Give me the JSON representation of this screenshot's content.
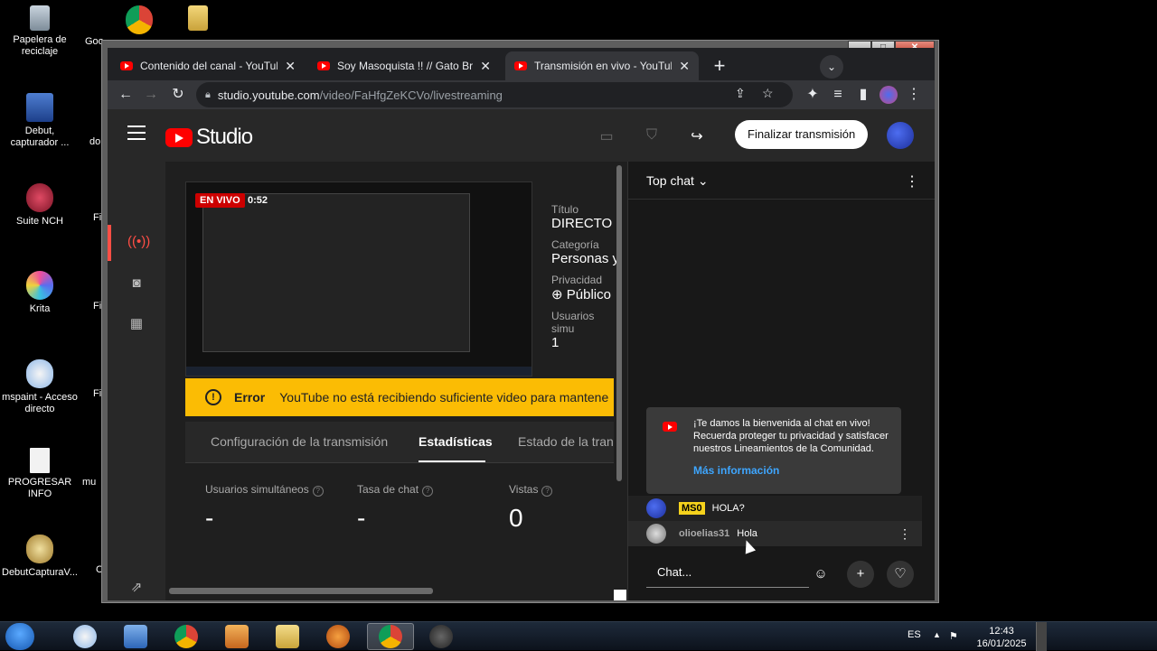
{
  "desktop": {
    "icons": [
      {
        "label": "Papelera de reciclaje",
        "icon": "recycle-bin-icon",
        "color": "#8fa3b5"
      },
      {
        "label": "Debut, capturador ...",
        "icon": "debut-icon",
        "color": "#2f5fb3"
      },
      {
        "label": "Suite NCH",
        "icon": "nch-suite-icon",
        "color": "#c0304a"
      },
      {
        "label": "Krita",
        "icon": "krita-icon",
        "color": "#d94bd6"
      },
      {
        "label": "mspaint - Acceso directo",
        "icon": "mspaint-icon",
        "color": "#e6c24a"
      },
      {
        "label": "PROGRESAR INFO",
        "icon": "document-icon",
        "color": "#f2f2f2"
      },
      {
        "label": "DebutCapturaV...",
        "icon": "installer-icon",
        "color": "#c9a44a"
      }
    ],
    "clipped_labels": [
      "Goo",
      "do",
      "Fi",
      "Fi",
      "Fi",
      "mu",
      "C"
    ]
  },
  "browser": {
    "tabs": [
      {
        "title": "Contenido del canal - YouTube St",
        "active": false
      },
      {
        "title": "Soy Masoquista !! // Gato Bros -",
        "active": false
      },
      {
        "title": "Transmisión en vivo - YouTube St",
        "active": true
      }
    ],
    "new_tab": "+",
    "url_host": "studio.youtube.com",
    "url_path": "/video/FaHfgZeKCVo/livestreaming"
  },
  "studio": {
    "logo_text": "Studio",
    "end_button": "Finalizar transmisión",
    "live_badge": "EN VIVO",
    "live_time": "0:52",
    "meta": {
      "title_label": "Título",
      "title_value": "DIRECTO",
      "category_label": "Categoría",
      "category_value": "Personas y",
      "privacy_label": "Privacidad",
      "privacy_value": "Público",
      "viewers_label": "Usuarios simu",
      "viewers_value": "1"
    },
    "error": {
      "title": "Error",
      "message": "YouTube no está recibiendo suficiente video para mantene"
    },
    "tabs": [
      {
        "label": "Configuración de la transmisión",
        "active": false
      },
      {
        "label": "Estadísticas",
        "active": true
      },
      {
        "label": "Estado de la trans",
        "active": false
      }
    ],
    "stats": [
      {
        "label": "Usuarios simultáneos",
        "value": "-"
      },
      {
        "label": "Tasa de chat",
        "value": "-"
      },
      {
        "label": "Vistas",
        "value": "0"
      }
    ]
  },
  "chat": {
    "title": "Top chat",
    "welcome_text": "¡Te damos la bienvenida al chat en vivo! Recuerda proteger tu privacidad y satisfacer nuestros Lineamientos de la Comunidad.",
    "welcome_link": "Más información",
    "messages": [
      {
        "author": "MS0",
        "text": "HOLA?",
        "badge": true
      },
      {
        "author": "olioelias31",
        "text": "Hola",
        "badge": false
      }
    ],
    "input_placeholder": "Chat..."
  },
  "taskbar": {
    "apps": [
      {
        "icon": "paint-icon",
        "color": "#8fb8e8"
      },
      {
        "icon": "control-panel-icon",
        "color": "#4a8fd8"
      },
      {
        "icon": "chrome-icon",
        "color": "#db4437"
      },
      {
        "icon": "media-player-icon",
        "color": "#e08a2a"
      },
      {
        "icon": "file-explorer-icon",
        "color": "#e6c96a"
      },
      {
        "icon": "fl-studio-icon",
        "color": "#e86b1f"
      },
      {
        "icon": "chrome-active-icon",
        "color": "#db4437"
      },
      {
        "icon": "obs-icon",
        "color": "#555555"
      }
    ],
    "lang": "ES",
    "time": "12:43",
    "date": "16/01/2025"
  }
}
